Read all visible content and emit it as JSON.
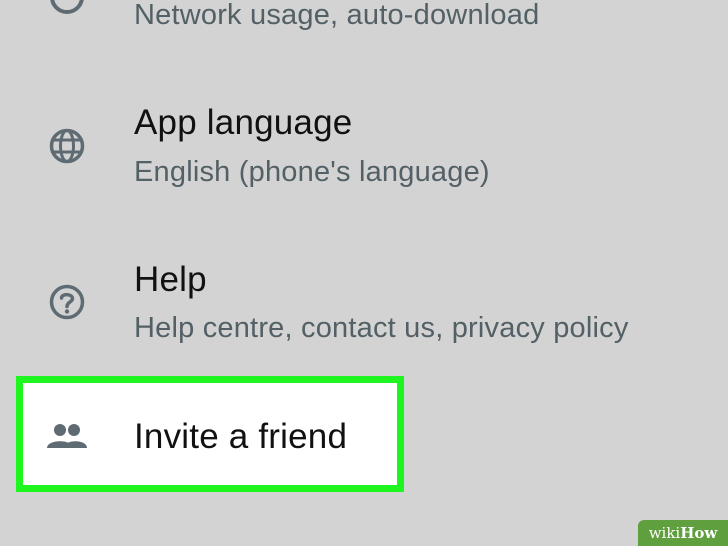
{
  "colors": {
    "background": "#d3d3d3",
    "title": "#111111",
    "subtitle": "#536066",
    "icon": "#5f6b73",
    "highlight_border": "#1ff51f",
    "highlight_fill": "#ffffff",
    "watermark": "#5f9f3e"
  },
  "settings": {
    "items": [
      {
        "icon": "data-usage-icon",
        "title": "",
        "subtitle": "Network usage, auto-download"
      },
      {
        "icon": "globe-icon",
        "title": "App language",
        "subtitle": "English (phone's language)"
      },
      {
        "icon": "help-circle-icon",
        "title": "Help",
        "subtitle": "Help centre, contact us, privacy policy"
      },
      {
        "icon": "people-icon",
        "title": "Invite a friend",
        "subtitle": "",
        "highlighted": true
      }
    ]
  },
  "watermark": {
    "part1": "wiki",
    "part2": "How"
  }
}
